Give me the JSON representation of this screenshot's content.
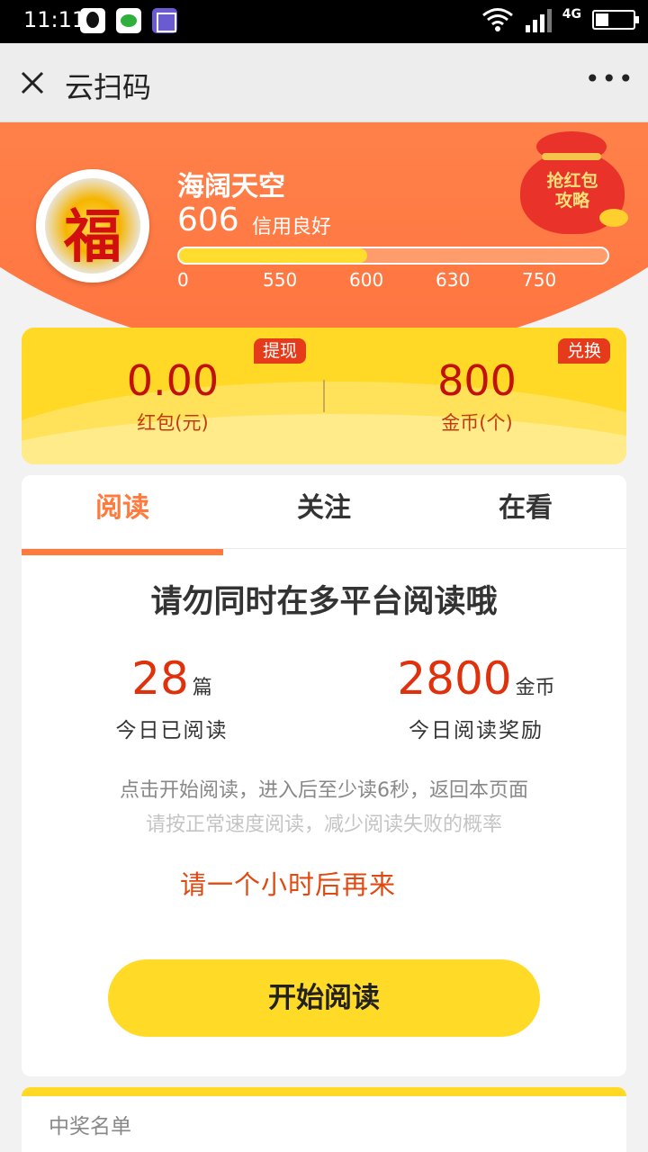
{
  "status_bar": {
    "time": "11:11",
    "network": "4G"
  },
  "nav": {
    "title": "云扫码",
    "more": "•••"
  },
  "profile": {
    "avatar_char": "福",
    "name": "海阔天空",
    "score": "606",
    "credit_label": "信用良好",
    "progress": 0.44,
    "ticks": [
      "0",
      "550",
      "600",
      "630",
      "750"
    ]
  },
  "promo": {
    "text": "抢红包\n攻略"
  },
  "wallet": {
    "redpacket_value": "0.00",
    "redpacket_label": "红包(元)",
    "withdraw_label": "提现",
    "coins_value": "800",
    "coins_label": "金币(个)",
    "exchange_label": "兑换"
  },
  "tabs": [
    {
      "label": "阅读",
      "active": true
    },
    {
      "label": "关注",
      "active": false
    },
    {
      "label": "在看",
      "active": false
    }
  ],
  "reading": {
    "warning": "请勿同时在多平台阅读哦",
    "read_count": "28",
    "read_unit": "篇",
    "read_label": "今日已阅读",
    "reward_value": "2800",
    "reward_unit": "金币",
    "reward_label": "今日阅读奖励",
    "tip1": "点击开始阅读，进入后至少读6秒，返回本页面",
    "tip2": "请按正常速度阅读，减少阅读失败的概率",
    "comeback": "请一个小时后再来",
    "start_button": "开始阅读"
  },
  "winners": {
    "title": "中奖名单"
  }
}
